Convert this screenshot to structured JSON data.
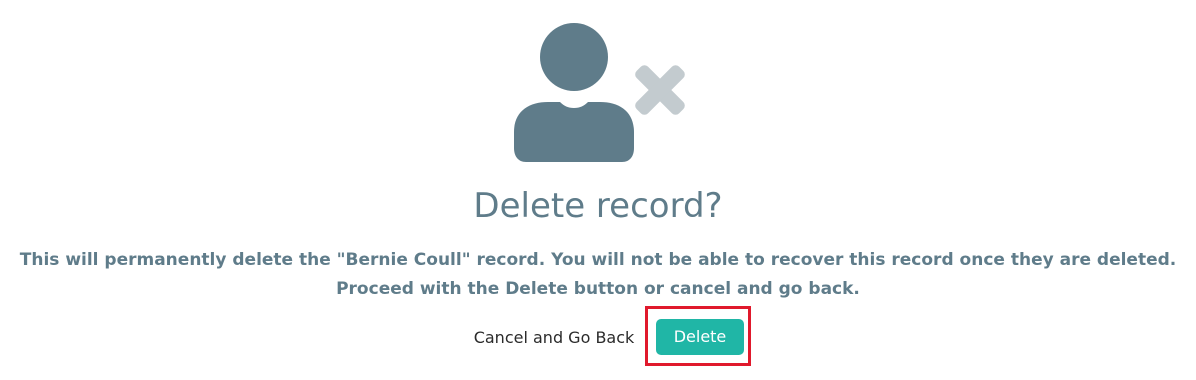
{
  "dialog": {
    "title": "Delete record?",
    "message_line1": "This will permanently delete the \"Bernie Coull\" record. You will not be able to recover this record once they are deleted.",
    "message_line2": "Proceed with the Delete button or cancel and go back.",
    "cancel_label": "Cancel and Go Back",
    "delete_label": "Delete"
  },
  "icons": {
    "hero_user": "user-icon",
    "hero_remove": "close-icon"
  },
  "colors": {
    "primary_text": "#5f7c8a",
    "icon_user": "#5f7c8a",
    "icon_x": "#c3cbcf",
    "delete_button": "#20b6a6",
    "delete_text": "#ffffff",
    "highlight_border": "#e0192c"
  }
}
